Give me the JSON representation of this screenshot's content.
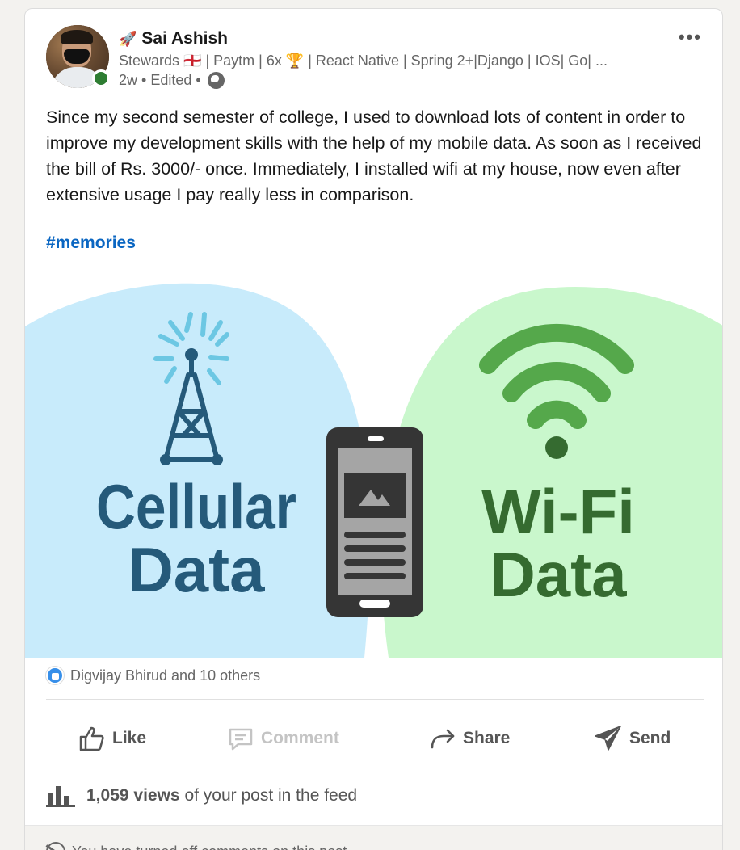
{
  "post": {
    "author_name": "Sai Ashish",
    "author_emoji": "🚀",
    "headline": "Stewards 🏴󠁧󠁢󠁥󠁮󠁧󠁿 | Paytm | 6x 🏆 | React Native | Spring 2+|Django | IOS| Go| ...",
    "age": "2w",
    "separator": "•",
    "edited": "Edited",
    "more_label": "•••",
    "body": "Since my second semester of college, I used to download lots of content in order to improve my development skills with the help of my mobile data. As soon as I received the bill of Rs. 3000/- once. Immediately, I installed wifi at my house, now even after extensive usage I pay really less in comparison.",
    "hashtag": "#memories"
  },
  "image": {
    "left_title_line1": "Cellular",
    "left_title_line2": "Data",
    "right_title_line1": "Wi-Fi",
    "right_title_line2": "Data",
    "colors": {
      "left_bg": "#c8ebfb",
      "right_bg": "#c9f7cc",
      "left_text": "#255a7a",
      "right_text": "#356b30",
      "tower": "#255a7a",
      "rays": "#6cc7e3",
      "wifi": "#55a84b",
      "phone": "#353535"
    }
  },
  "reactions": {
    "text": "Digvijay Bhirud and 10 others"
  },
  "actions": {
    "like": "Like",
    "comment": "Comment",
    "share": "Share",
    "send": "Send"
  },
  "views": {
    "count": "1,059 views",
    "suffix": "of your post in the feed"
  },
  "footer": {
    "text": "You have turned off comments on this post"
  }
}
